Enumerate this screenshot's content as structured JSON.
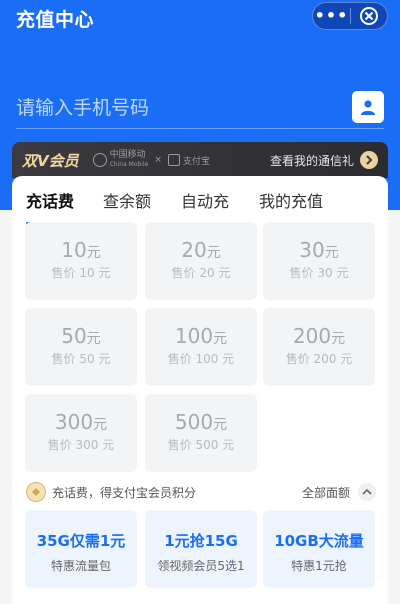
{
  "header": {
    "title": "充值中心"
  },
  "capsule": {
    "more": "•••"
  },
  "phone": {
    "placeholder": "请输入手机号码"
  },
  "vip": {
    "title": "双V会员",
    "partner1": "中国移动",
    "partner1_en": "China Mobile",
    "partner2": "支付宝",
    "link": "查看我的通信礼"
  },
  "tabs": [
    "充话费",
    "查余额",
    "自动充",
    "我的充值"
  ],
  "amounts": [
    {
      "value": "10",
      "unit": "元",
      "price": "售价 10 元"
    },
    {
      "value": "20",
      "unit": "元",
      "price": "售价 20 元"
    },
    {
      "value": "30",
      "unit": "元",
      "price": "售价 30 元"
    },
    {
      "value": "50",
      "unit": "元",
      "price": "售价 50 元"
    },
    {
      "value": "100",
      "unit": "元",
      "price": "售价 100 元"
    },
    {
      "value": "200",
      "unit": "元",
      "price": "售价 200 元"
    },
    {
      "value": "300",
      "unit": "元",
      "price": "售价 300 元"
    },
    {
      "value": "500",
      "unit": "元",
      "price": "售价 500 元"
    }
  ],
  "points": {
    "text": "充话费，得支付宝会员积分",
    "all": "全部面额"
  },
  "promos": [
    {
      "title": "35G仅需1元",
      "subtitle": "特惠流量包"
    },
    {
      "title": "1元抢15G",
      "subtitle": "领视频会员5选1"
    },
    {
      "title": "10GB大流量",
      "subtitle": "特惠1元抢"
    }
  ],
  "colors": {
    "brand_blue": "#1a6ef5",
    "vip_gold": "#f0d79c"
  }
}
